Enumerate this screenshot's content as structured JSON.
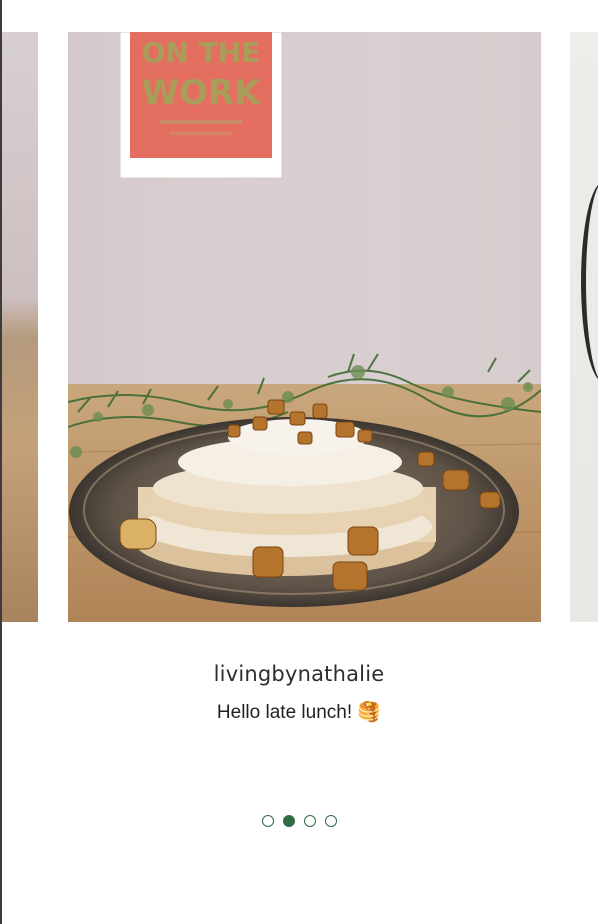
{
  "post": {
    "username": "livingbynathalie",
    "caption": "Hello late lunch! 🥞",
    "image_icon": "pancake-stack-photo",
    "poster_text_line1": "ON THE",
    "poster_text_line2": "WORK"
  },
  "pagination": {
    "pages": 4,
    "active_index": 1
  },
  "colors": {
    "accent": "#2f6b45",
    "background": "#ffffff",
    "text": "#222222"
  }
}
